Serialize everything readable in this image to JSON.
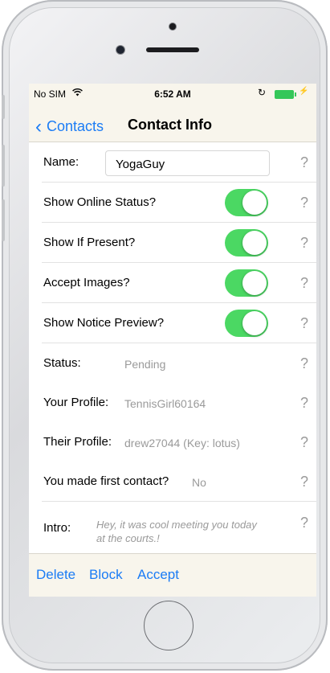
{
  "status_bar": {
    "carrier": "No SIM",
    "time": "6:52 AM",
    "wifi_icon": "wifi-icon",
    "battery_color": "#35c759"
  },
  "nav": {
    "back_label": "Contacts",
    "title": "Contact Info"
  },
  "rows": {
    "name_label": "Name:",
    "name_value": "YogaGuy",
    "online_label": "Show Online Status?",
    "present_label": "Show If Present?",
    "images_label": "Accept Images?",
    "notice_label": "Show Notice Preview?",
    "status_label": "Status:",
    "status_value": "Pending",
    "your_profile_label": "Your Profile:",
    "your_profile_value": "TennisGirl60164",
    "their_profile_label": "Their Profile:",
    "their_profile_value": "drew27044 (Key: lotus)",
    "first_contact_label": "You made first contact?",
    "first_contact_value": "No",
    "intro_label": "Intro:",
    "intro_value": "Hey, it was cool meeting you today at the courts.!",
    "help": "?"
  },
  "toggles": {
    "show_online_status": true,
    "show_if_present": true,
    "accept_images": true,
    "show_notice_preview": true
  },
  "toolbar": {
    "delete_label": "Delete",
    "block_label": "Block",
    "accept_label": "Accept"
  },
  "colors": {
    "accent": "#1b7cf5",
    "toggle_on": "#4bd863",
    "bar_background": "#f8f5ec"
  }
}
